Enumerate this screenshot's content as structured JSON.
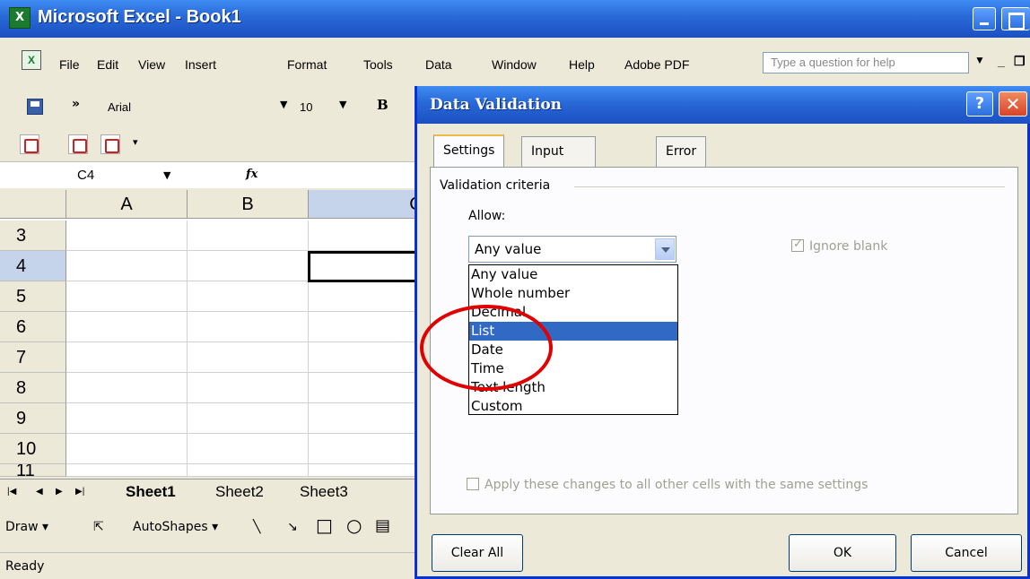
{
  "window": {
    "title": "Microsoft Excel - Book1"
  },
  "menubar": {
    "items": [
      "File",
      "Edit",
      "View",
      "Insert",
      "Format",
      "Tools",
      "Data",
      "Window",
      "Help",
      "Adobe PDF"
    ],
    "help_placeholder": "Type a question for help"
  },
  "format_toolbar": {
    "font": "Arial",
    "size": "10",
    "bold": "B"
  },
  "formula_bar": {
    "name_box": "C4",
    "fx": "fx"
  },
  "grid": {
    "columns": [
      "A",
      "B",
      "C"
    ],
    "rows": [
      "3",
      "4",
      "5",
      "6",
      "7",
      "8",
      "9",
      "10",
      "11"
    ],
    "active_cell": "C4"
  },
  "sheet_tabs": [
    "Sheet1",
    "Sheet2",
    "Sheet3"
  ],
  "draw_toolbar": {
    "draw": "Draw ▾",
    "autoshapes": "AutoShapes ▾"
  },
  "status": "Ready",
  "dialog": {
    "title": "Data Validation",
    "tabs": [
      "Settings",
      "Input Message",
      "Error Alert"
    ],
    "active_tab": "Settings",
    "group_label": "Validation criteria",
    "allow_label": "Allow:",
    "allow_value": "Any value",
    "allow_options": [
      "Any value",
      "Whole number",
      "Decimal",
      "List",
      "Date",
      "Time",
      "Text length",
      "Custom"
    ],
    "highlighted_option": "List",
    "ignore_blank": "Ignore blank",
    "apply_all": "Apply these changes to all other cells with the same settings",
    "buttons": {
      "clear_all": "Clear All",
      "ok": "OK",
      "cancel": "Cancel"
    }
  },
  "colors": {
    "titlebar": "#2a6bd8",
    "selection": "#316ac5",
    "annotation": "#e00000"
  }
}
